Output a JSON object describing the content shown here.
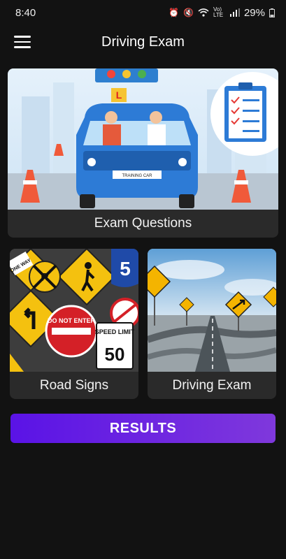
{
  "status_bar": {
    "time": "8:40",
    "network_label": "Vo) LTE",
    "battery_text": "29%"
  },
  "app_bar": {
    "title": "Driving Exam",
    "menu_icon": "hamburger-menu-icon"
  },
  "cards": [
    {
      "label": "Exam Questions",
      "illustration": "training-car-illustration"
    },
    {
      "label": "Road Signs",
      "illustration": "road-signs-photo"
    },
    {
      "label": "Driving Exam",
      "illustration": "road-photo"
    }
  ],
  "illustration_text": {
    "car_plate": "TRAINING CAR",
    "learner_badge": "L",
    "sign_do_not_enter": "DO NOT ENTER",
    "sign_speed_limit": "SPEED LIMIT",
    "sign_speed_value": "50",
    "sign_route_number": "5",
    "sign_one_way": "ONE WAY",
    "sign_railroad": "R"
  },
  "results_button": {
    "label": "RESULTS"
  },
  "colors": {
    "background": "#121212",
    "card": "#2a2a2a",
    "button_start": "#5a13e6",
    "button_end": "#7f38dc"
  }
}
